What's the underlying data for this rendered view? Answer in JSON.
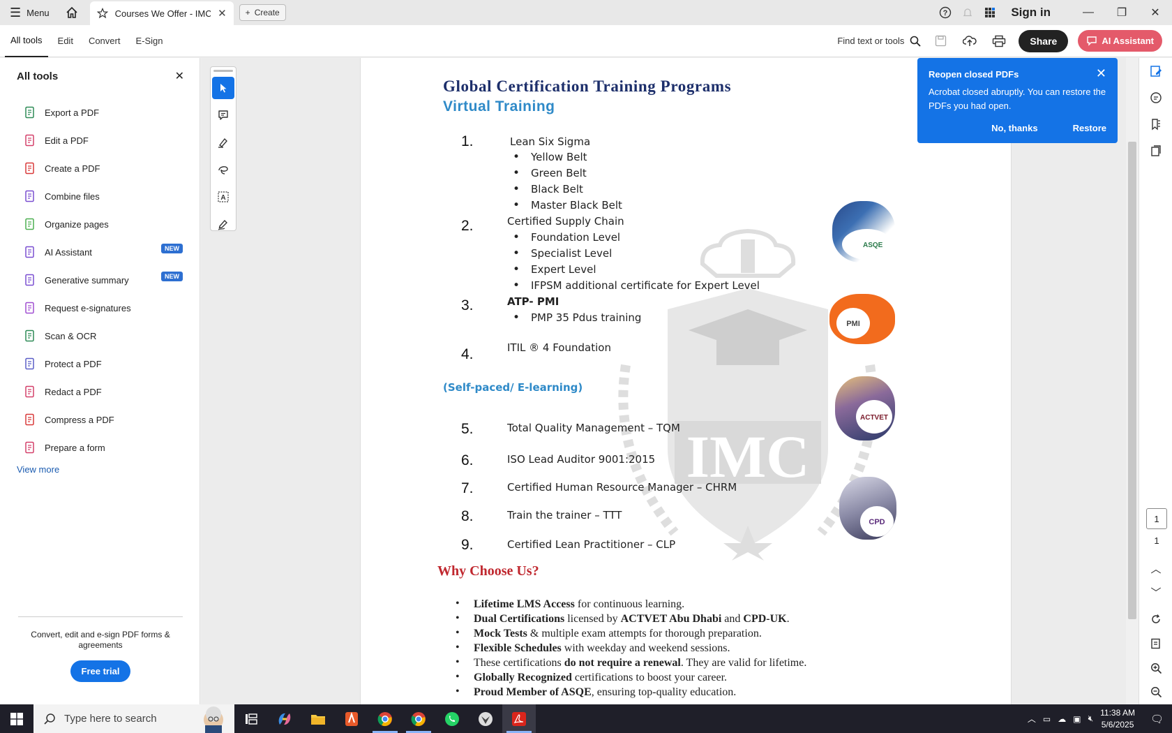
{
  "titlebar": {
    "menu_label": "Menu",
    "tab_title": "Courses We Offer - IMC -...",
    "create_label": "Create",
    "signin_label": "Sign in"
  },
  "toolbar": {
    "tabs": [
      "All tools",
      "Edit",
      "Convert",
      "E-Sign"
    ],
    "find_label": "Find text or tools",
    "share_label": "Share",
    "ai_label": "AI Assistant"
  },
  "left_panel": {
    "title": "All tools",
    "tools": [
      {
        "label": "Export a PDF",
        "icon": "export-pdf-icon",
        "color": "#2e8b57"
      },
      {
        "label": "Edit a PDF",
        "icon": "edit-pdf-icon",
        "color": "#d4406a"
      },
      {
        "label": "Create a PDF",
        "icon": "create-pdf-icon",
        "color": "#d93a3a"
      },
      {
        "label": "Combine files",
        "icon": "combine-files-icon",
        "color": "#7a4fd1"
      },
      {
        "label": "Organize pages",
        "icon": "organize-pages-icon",
        "color": "#4caf50"
      },
      {
        "label": "AI Assistant",
        "icon": "ai-assistant-icon",
        "color": "#7a4fd1",
        "badge": "NEW"
      },
      {
        "label": "Generative summary",
        "icon": "generative-summary-icon",
        "color": "#7a4fd1",
        "badge": "NEW"
      },
      {
        "label": "Request e-signatures",
        "icon": "request-esign-icon",
        "color": "#a04fd1"
      },
      {
        "label": "Scan & OCR",
        "icon": "scan-ocr-icon",
        "color": "#2e8b57"
      },
      {
        "label": "Protect a PDF",
        "icon": "protect-pdf-icon",
        "color": "#5b5fc7"
      },
      {
        "label": "Redact a PDF",
        "icon": "redact-pdf-icon",
        "color": "#d4406a"
      },
      {
        "label": "Compress a PDF",
        "icon": "compress-pdf-icon",
        "color": "#d93a3a"
      },
      {
        "label": "Prepare a form",
        "icon": "prepare-form-icon",
        "color": "#d4406a"
      }
    ],
    "view_more": "View more",
    "footer_msg": "Convert, edit and e-sign PDF forms & agreements",
    "trial_label": "Free trial"
  },
  "document": {
    "title": "Global Certification Training Programs",
    "subtitle": "Virtual Training",
    "sections": {
      "n1": "1.",
      "i1": "Lean Six Sigma",
      "b1": [
        "Yellow Belt",
        "Green Belt",
        "Black Belt",
        "Master Black Belt"
      ],
      "n2": "2.",
      "i2": "Certified Supply Chain",
      "b2": [
        "Foundation Level",
        "Specialist Level",
        "Expert Level",
        "IFPSM additional certificate for Expert Level"
      ],
      "n3": "3.",
      "i3": "ATP- PMI",
      "b3": [
        "PMP 35 Pdus training"
      ],
      "n4": "4.",
      "i4": "ITIL  ® 4 Foundation",
      "selfpaced": "(Self-paced/ E-learning)",
      "n5": "5.",
      "i5": "Total Quality Management – TQM",
      "n6": "6.",
      "i6": "ISO Lead Auditor 9001:2015",
      "n7": "7.",
      "i7": "Certified Human Resource Manager – CHRM",
      "n8": "8.",
      "i8": "Train the trainer – TTT",
      "n9": "9.",
      "i9": "Certified Lean Practitioner – CLP"
    },
    "why_title": "Why Choose Us?",
    "why": [
      {
        "b": "Lifetime LMS Access",
        "t": " for continuous learning."
      },
      {
        "b": "Dual Certifications",
        "t": " licensed by ",
        "b2": "ACTVET Abu Dhabi",
        "t2": " and ",
        "b3": "CPD-UK",
        "t3": "."
      },
      {
        "b": "Mock Tests",
        "t": " & multiple exam attempts for thorough preparation."
      },
      {
        "b": "Flexible Schedules",
        "t": " with weekday and weekend sessions."
      },
      {
        "b": "",
        "t": "These certifications ",
        "b2": "do not require a renewal",
        "t2": ". They are valid for lifetime."
      },
      {
        "b": "Globally Recognized",
        "t": " certifications to boost your career."
      },
      {
        "b": "Proud Member of ASQE",
        "t": ", ensuring top-quality education."
      }
    ],
    "watermark_text": "IMC",
    "logos": {
      "asq": "ASQE",
      "pmi": "PMI",
      "actvet": "ACTVET",
      "cpd": "CPD"
    }
  },
  "toast": {
    "title": "Reopen closed PDFs",
    "message": "Acrobat closed abruptly. You can restore the PDFs you had open.",
    "no_thanks": "No, thanks",
    "restore": "Restore"
  },
  "rail": {
    "page_current": "1",
    "page_total": "1"
  },
  "taskbar": {
    "search_placeholder": "Type here to search",
    "time": "11:38 AM",
    "date": "5/6/2025"
  }
}
